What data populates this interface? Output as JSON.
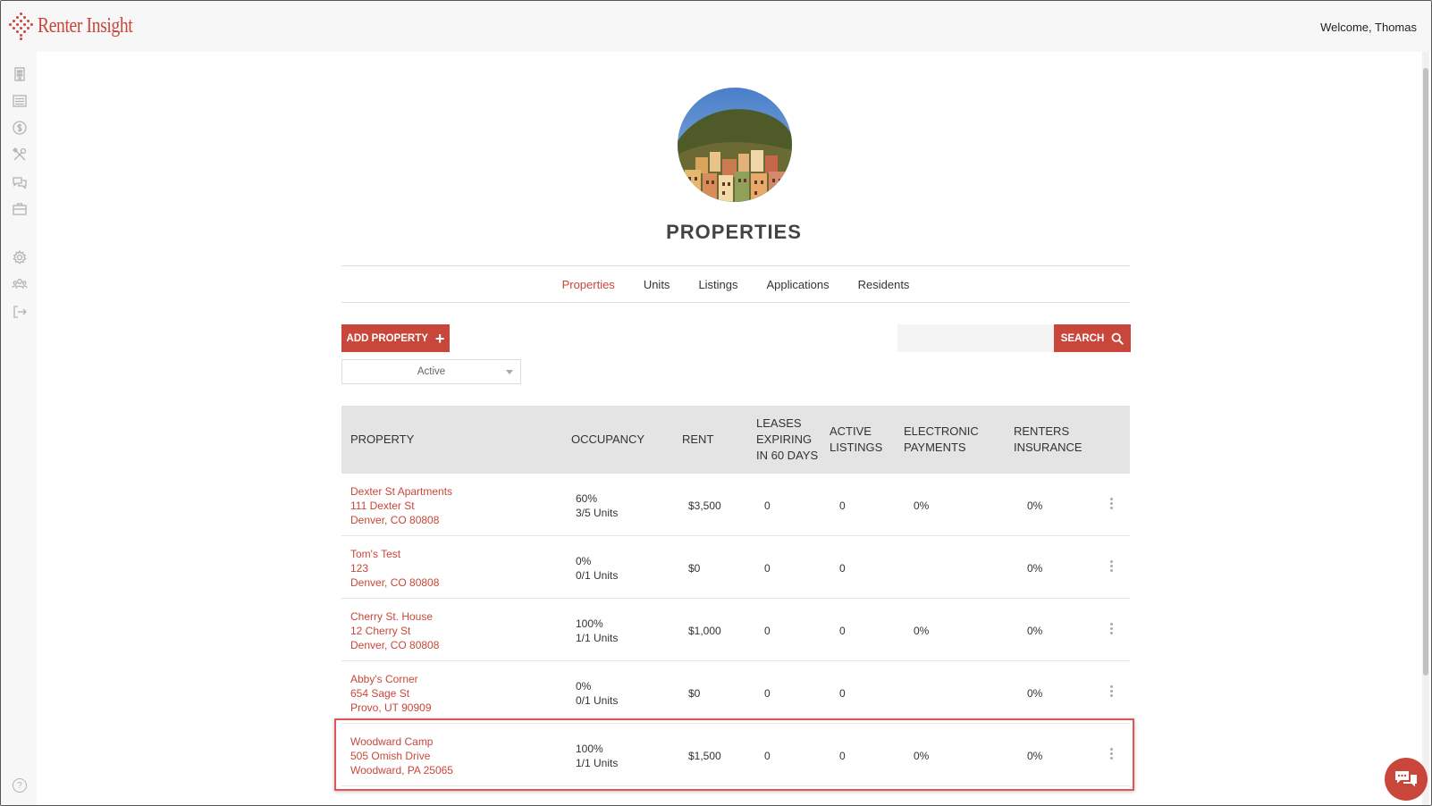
{
  "app": {
    "logo_text": "Renter Insight",
    "welcome": "Welcome, Thomas",
    "accent": "#c8473a"
  },
  "sidebar": {
    "items": [
      {
        "name": "building-icon"
      },
      {
        "name": "list-icon"
      },
      {
        "name": "dollar-icon"
      },
      {
        "name": "tools-icon"
      },
      {
        "name": "chat-icon"
      },
      {
        "name": "briefcase-icon"
      },
      {
        "name": "gear-icon"
      },
      {
        "name": "users-icon"
      },
      {
        "name": "logout-icon"
      }
    ],
    "help_label": "?"
  },
  "page": {
    "title": "PROPERTIES"
  },
  "tabs": [
    {
      "label": "Properties",
      "active": true
    },
    {
      "label": "Units",
      "active": false
    },
    {
      "label": "Listings",
      "active": false
    },
    {
      "label": "Applications",
      "active": false
    },
    {
      "label": "Residents",
      "active": false
    }
  ],
  "toolbar": {
    "add_label": "ADD PROPERTY",
    "search_label": "SEARCH",
    "search_value": "",
    "filter_value": "Active"
  },
  "table": {
    "headers": {
      "property": "PROPERTY",
      "occupancy": "OCCUPANCY",
      "rent": "RENT",
      "leases_1": "LEASES",
      "leases_2": "EXPIRING",
      "leases_3": "IN 60 DAYS",
      "listings_1": "ACTIVE",
      "listings_2": "LISTINGS",
      "payments_1": "ELECTRONIC",
      "payments_2": "PAYMENTS",
      "insurance_1": "RENTERS",
      "insurance_2": "INSURANCE"
    },
    "rows": [
      {
        "name": "Dexter St Apartments",
        "street": "111 Dexter St",
        "city": "Denver, CO 80808",
        "occ_pct": "60%",
        "occ_units": "3/5 Units",
        "rent": "$3,500",
        "leases": "0",
        "listings": "0",
        "payments": "0%",
        "insurance": "0%"
      },
      {
        "name": "Tom's Test",
        "street": "123",
        "city": "Denver, CO 80808",
        "occ_pct": "0%",
        "occ_units": "0/1 Units",
        "rent": "$0",
        "leases": "0",
        "listings": "0",
        "payments": "",
        "insurance": "0%"
      },
      {
        "name": "Cherry St. House",
        "street": "12 Cherry St",
        "city": "Denver, CO 80808",
        "occ_pct": "100%",
        "occ_units": "1/1 Units",
        "rent": "$1,000",
        "leases": "0",
        "listings": "0",
        "payments": "0%",
        "insurance": "0%"
      },
      {
        "name": "Abby's Corner",
        "street": "654 Sage St",
        "city": "Provo, UT 90909",
        "occ_pct": "0%",
        "occ_units": "0/1 Units",
        "rent": "$0",
        "leases": "0",
        "listings": "0",
        "payments": "",
        "insurance": "0%"
      },
      {
        "name": "Woodward Camp",
        "street": "505 Omish Drive",
        "city": "Woodward, PA 25065",
        "occ_pct": "100%",
        "occ_units": "1/1 Units",
        "rent": "$1,500",
        "leases": "0",
        "listings": "0",
        "payments": "0%",
        "insurance": "0%"
      }
    ]
  }
}
